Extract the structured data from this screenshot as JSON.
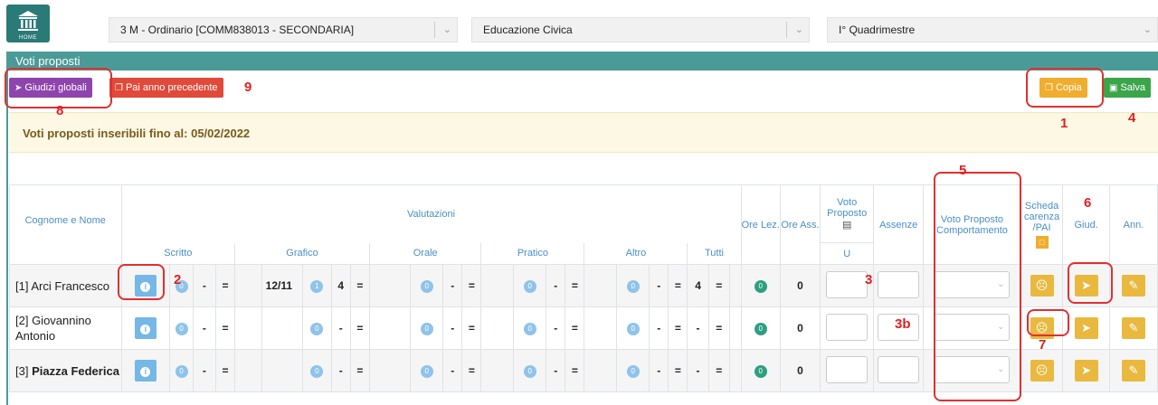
{
  "header": {
    "logo_text": "HOME",
    "class_select": "3 M - Ordinario [COMM838013 - SECONDARIA]",
    "subject_select": "Educazione Civica",
    "period_select": "I° Quadrimestre"
  },
  "panel": {
    "title": "Voti proposti"
  },
  "toolbar": {
    "giudizi": "Giudizi globali",
    "pai": "Pai anno precedente",
    "copia": "Copia",
    "salva": "Salva"
  },
  "warning": "Voti proposti inseribili fino al: 05/02/2022",
  "table": {
    "headers": {
      "name": "Cognome e Nome",
      "valutazioni": "Valutazioni",
      "ore_lez": "Ore Lez.",
      "ore_ass": "Ore Ass.",
      "voto_proposto": "Voto Proposto",
      "assenze": "Assenze",
      "voto_comp": "Voto Proposto Comportamento",
      "scheda": "Scheda carenza /PAI",
      "giud": "Giud.",
      "ann": "Ann."
    },
    "subheaders": {
      "scritto": "Scritto",
      "grafico": "Grafico",
      "orale": "Orale",
      "pratico": "Pratico",
      "altro": "Altro",
      "tutti": "Tutti",
      "u": "U"
    },
    "rows": [
      {
        "name": "[1] Arci Francesco",
        "scritto": {
          "count": "0",
          "avg": "-",
          "sym": "="
        },
        "grafico_date": "12/11",
        "grafico": {
          "count": "1",
          "avg": "4",
          "sym": "="
        },
        "orale": {
          "count": "0",
          "avg": "-",
          "sym": "="
        },
        "pratico": {
          "count": "0",
          "avg": "-",
          "sym": "="
        },
        "altro": {
          "count": "0",
          "avg": "-",
          "sym": "="
        },
        "tutti": {
          "avg": "4",
          "sym": "="
        },
        "ore_lez": "0",
        "ore_ass": "0"
      },
      {
        "name": "[2] Giovannino Antonio",
        "scritto": {
          "count": "0",
          "avg": "-",
          "sym": "="
        },
        "grafico_date": "",
        "grafico": {
          "count": "0",
          "avg": "-",
          "sym": "="
        },
        "orale": {
          "count": "0",
          "avg": "-",
          "sym": "="
        },
        "pratico": {
          "count": "0",
          "avg": "-",
          "sym": "="
        },
        "altro": {
          "count": "0",
          "avg": "-",
          "sym": "="
        },
        "tutti": {
          "avg": "-",
          "sym": "="
        },
        "ore_lez": "0",
        "ore_ass": "0"
      },
      {
        "name_prefix": "[3]",
        "name_bold": "Piazza Federica",
        "scritto": {
          "count": "0",
          "avg": "-",
          "sym": "="
        },
        "grafico_date": "",
        "grafico": {
          "count": "0",
          "avg": "-",
          "sym": "="
        },
        "orale": {
          "count": "0",
          "avg": "-",
          "sym": "="
        },
        "pratico": {
          "count": "0",
          "avg": "-",
          "sym": "="
        },
        "altro": {
          "count": "0",
          "avg": "-",
          "sym": "="
        },
        "tutti": {
          "avg": "-",
          "sym": "="
        },
        "ore_lez": "0",
        "ore_ass": "0"
      }
    ]
  },
  "annotations": {
    "a1": "1",
    "a2": "2",
    "a3": "3",
    "a3b": "3b",
    "a4": "4",
    "a5": "5",
    "a6": "6",
    "a7": "7",
    "a8": "8",
    "a9": "9"
  },
  "colors": {
    "teal": "#4a9b98",
    "purple": "#8e44ad",
    "red": "#e04a3a",
    "orange": "#f0ad2e",
    "green": "#3aa54a",
    "annotation": "#e02020"
  }
}
